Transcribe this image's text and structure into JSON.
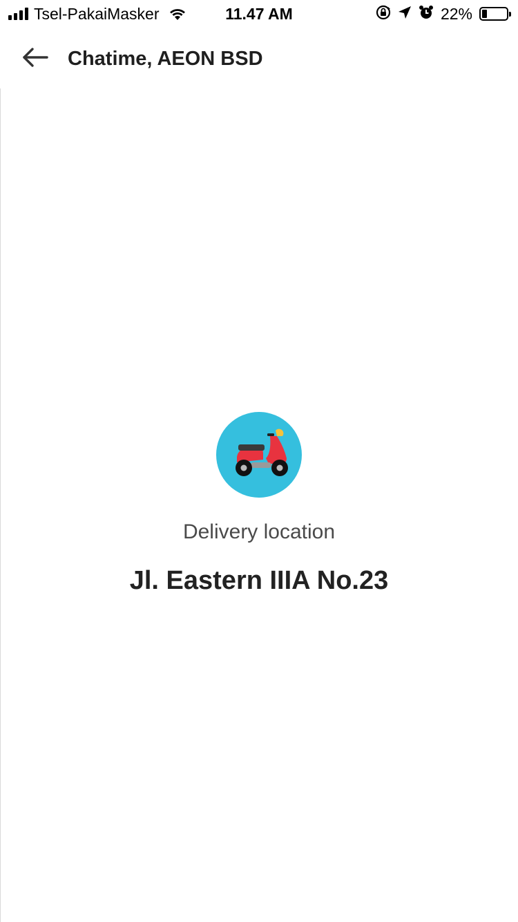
{
  "status_bar": {
    "carrier": "Tsel-PakaiMasker",
    "time": "11.47 AM",
    "battery_percent_text": "22%",
    "battery_level": 0.22
  },
  "header": {
    "back_icon": "arrow-left-icon",
    "title": "Chatime, AEON BSD"
  },
  "delivery": {
    "icon": "scooter-icon",
    "label": "Delivery location",
    "address": "Jl. Eastern IIIA No.23"
  },
  "colors": {
    "badge_bg": "#35bfde",
    "scooter_body": "#e8333f",
    "text_primary": "#222222",
    "text_secondary": "#4a4a4a"
  }
}
